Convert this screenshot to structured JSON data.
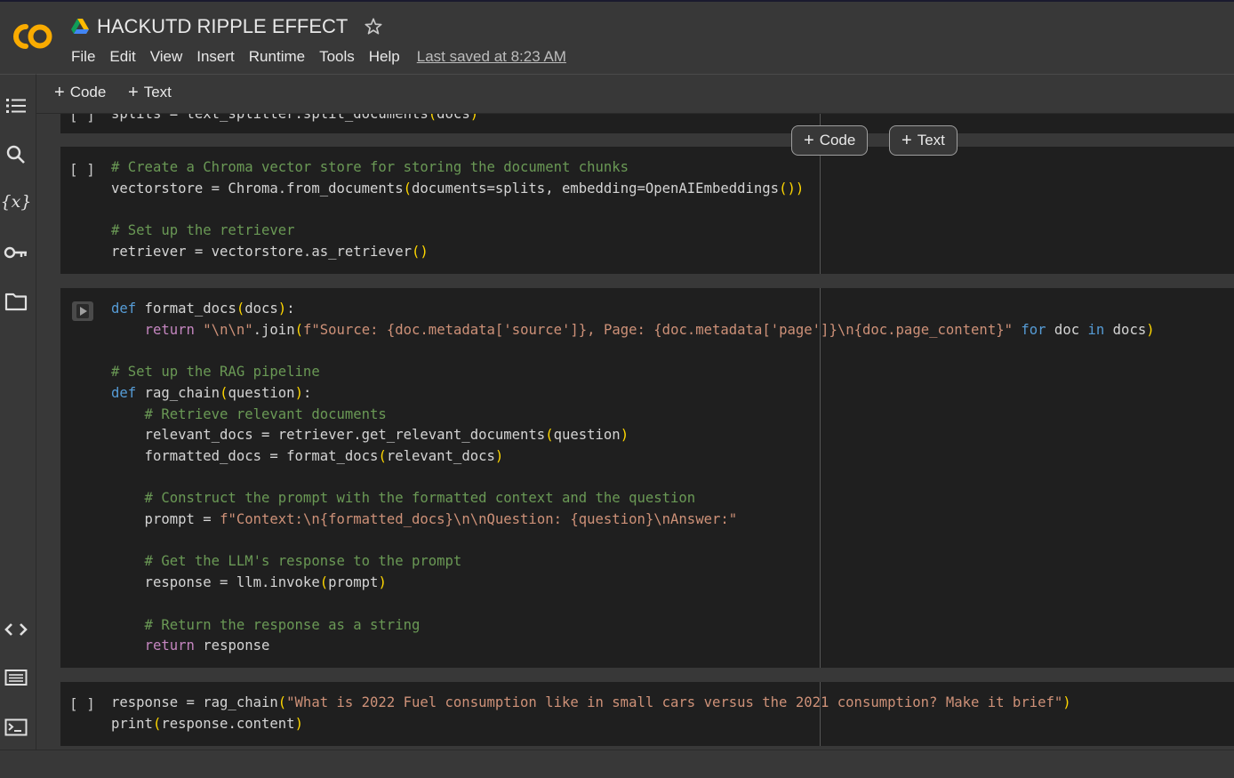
{
  "header": {
    "title": "HACKUTD RIPPLE EFFECT",
    "menu": [
      "File",
      "Edit",
      "View",
      "Insert",
      "Runtime",
      "Tools",
      "Help"
    ],
    "last_saved": "Last saved at 8:23 AM",
    "logo_icon": "colab-logo",
    "drive_icon": "google-drive-icon",
    "star_icon": "star-icon"
  },
  "toolbar": {
    "add_code": "Code",
    "add_text": "Text"
  },
  "sidebar": {
    "icons": [
      "table-of-contents-icon",
      "search-icon",
      "variables-icon",
      "secrets-key-icon",
      "files-folder-icon",
      "code-snippets-icon",
      "command-palette-icon",
      "terminal-icon"
    ]
  },
  "floating": {
    "add_code": "Code",
    "add_text": "Text"
  },
  "cells": [
    {
      "bracket": "[ ]",
      "lines": [
        "splits = text_splitter.split_documents(docs)"
      ]
    },
    {
      "bracket": "[ ]",
      "lines": [
        "# Create a Chroma vector store for storing the document chunks",
        "vectorstore = Chroma.from_documents(documents=splits, embedding=OpenAIEmbeddings())",
        "",
        "# Set up the retriever",
        "retriever = vectorstore.as_retriever()"
      ]
    },
    {
      "bracket": "",
      "lines": [
        "def format_docs(docs):",
        "    return \"\\n\\n\".join(f\"Source: {doc.metadata['source']}, Page: {doc.metadata['page']}\\n{doc.page_content}\" for doc in docs)",
        "",
        "# Set up the RAG pipeline",
        "def rag_chain(question):",
        "    # Retrieve relevant documents",
        "    relevant_docs = retriever.get_relevant_documents(question)",
        "    formatted_docs = format_docs(relevant_docs)",
        "",
        "    # Construct the prompt with the formatted context and the question",
        "    prompt = f\"Context:\\n{formatted_docs}\\n\\nQuestion: {question}\\nAnswer:\"",
        "",
        "    # Get the LLM's response to the prompt",
        "    response = llm.invoke(prompt)",
        "",
        "    # Return the response as a string",
        "    return response"
      ]
    },
    {
      "bracket": "[ ]",
      "lines": [
        "response = rag_chain(\"What is 2022 Fuel consumption like in small cars versus the 2021 consumption? Make it brief\")",
        "print(response.content)"
      ]
    }
  ],
  "colors": {
    "comment": "#6a9955",
    "keyword": "#569cd6",
    "return_keyword": "#c586c0",
    "string": "#ce9178",
    "brace": "#ffd700",
    "cell_bg": "#1f1f1f",
    "page_bg": "#383838",
    "logo_orange": "#f9ab00"
  }
}
